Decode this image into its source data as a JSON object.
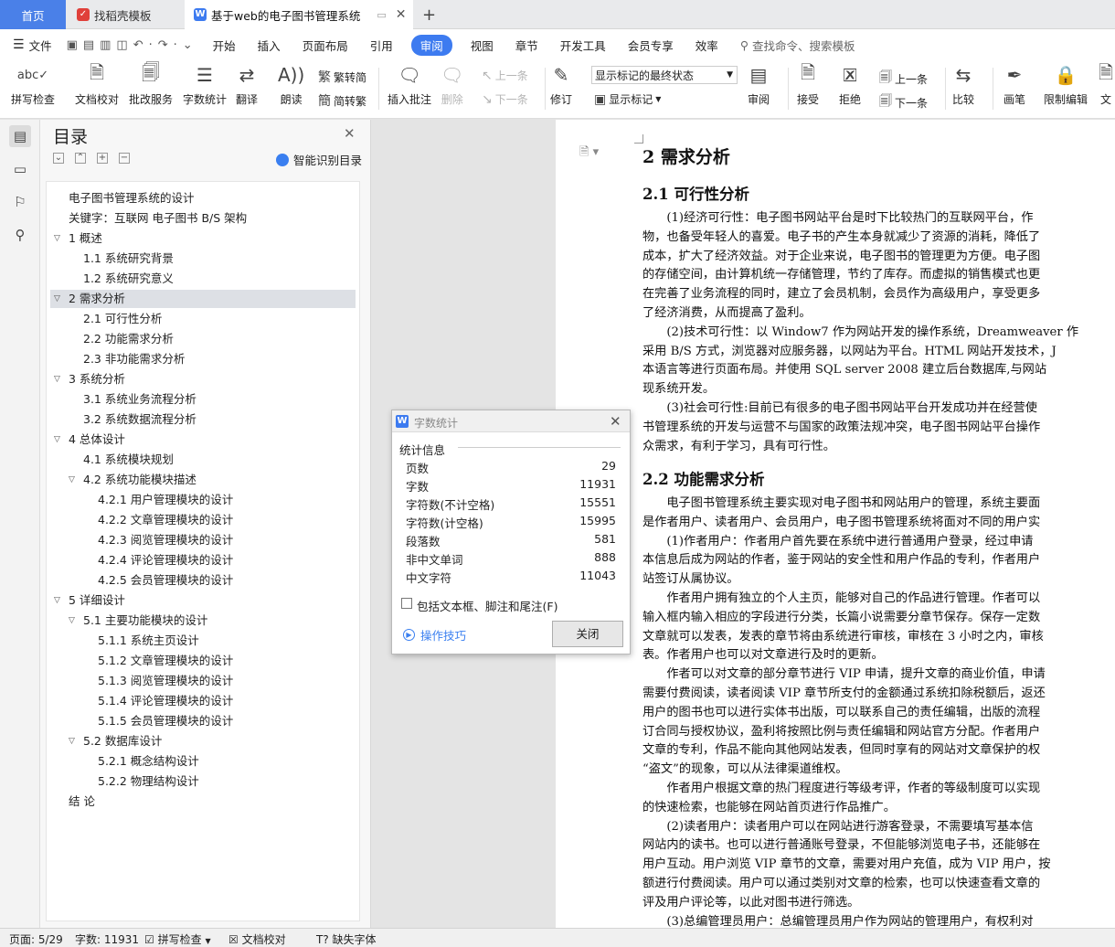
{
  "tabs": {
    "home": "首页",
    "template": "找稻壳模板",
    "doc": "基于web的电子图书管理系统",
    "add": "+"
  },
  "menu": {
    "file": "文件",
    "items": [
      "开始",
      "插入",
      "页面布局",
      "引用",
      "审阅",
      "视图",
      "章节",
      "开发工具",
      "会员专享",
      "效率"
    ],
    "active": "审阅",
    "search": "查找命令、搜索模板"
  },
  "toolbar": {
    "spell": "拼写检查",
    "proof": "文档校对",
    "batch": "批改服务",
    "wordcount": "字数统计",
    "translate": "翻译",
    "read": "朗读",
    "to_trad": "繁转简",
    "to_simp": "简转繁",
    "insert_comment": "插入批注",
    "delete": "删除",
    "prev": "上一条",
    "next": "下一条",
    "revise": "修订",
    "markup_select": "显示标记的最终状态",
    "show_markup": "显示标记",
    "review": "审阅",
    "accept": "接受",
    "reject": "拒绝",
    "prev2": "上一条",
    "next2": "下一条",
    "compare": "比较",
    "ink": "画笔",
    "restrict": "限制编辑",
    "doc_cut": "文"
  },
  "toc": {
    "title": "目录",
    "smart": "智能识别目录",
    "items": [
      {
        "text": "电子图书管理系统的设计",
        "level": 0,
        "arrow": ""
      },
      {
        "text": "关键字：互联网  电子图书  B/S 架构",
        "level": 0,
        "arrow": ""
      },
      {
        "text": "1 概述",
        "level": 0,
        "arrow": "v"
      },
      {
        "text": "1.1 系统研究背景",
        "level": 1,
        "arrow": ""
      },
      {
        "text": "1.2 系统研究意义",
        "level": 1,
        "arrow": ""
      },
      {
        "text": "2  需求分析",
        "level": 0,
        "arrow": "v",
        "selected": true
      },
      {
        "text": "2.1 可行性分析",
        "level": 1,
        "arrow": ""
      },
      {
        "text": "2.2 功能需求分析",
        "level": 1,
        "arrow": ""
      },
      {
        "text": "2.3 非功能需求分析",
        "level": 1,
        "arrow": ""
      },
      {
        "text": "3 系统分析",
        "level": 0,
        "arrow": "v"
      },
      {
        "text": "3.1 系统业务流程分析",
        "level": 1,
        "arrow": ""
      },
      {
        "text": "3.2 系统数据流程分析",
        "level": 1,
        "arrow": ""
      },
      {
        "text": "4 总体设计",
        "level": 0,
        "arrow": "v"
      },
      {
        "text": "4.1 系统模块规划",
        "level": 1,
        "arrow": ""
      },
      {
        "text": "4.2 系统功能模块描述",
        "level": 1,
        "arrow": "v"
      },
      {
        "text": "4.2.1 用户管理模块的设计",
        "level": 2,
        "arrow": ""
      },
      {
        "text": "4.2.2 文章管理模块的设计",
        "level": 2,
        "arrow": ""
      },
      {
        "text": "4.2.3 阅览管理模块的设计",
        "level": 2,
        "arrow": ""
      },
      {
        "text": "4.2.4 评论管理模块的设计",
        "level": 2,
        "arrow": ""
      },
      {
        "text": "4.2.5 会员管理模块的设计",
        "level": 2,
        "arrow": ""
      },
      {
        "text": "5 详细设计",
        "level": 0,
        "arrow": "v"
      },
      {
        "text": "5.1 主要功能模块的设计",
        "level": 1,
        "arrow": "v"
      },
      {
        "text": "5.1.1 系统主页设计",
        "level": 2,
        "arrow": ""
      },
      {
        "text": "5.1.2 文章管理模块的设计",
        "level": 2,
        "arrow": ""
      },
      {
        "text": "5.1.3 阅览管理模块的设计",
        "level": 2,
        "arrow": ""
      },
      {
        "text": "5.1.4 评论管理模块的设计",
        "level": 2,
        "arrow": ""
      },
      {
        "text": "5.1.5 会员管理模块的设计",
        "level": 2,
        "arrow": ""
      },
      {
        "text": "5.2 数据库设计",
        "level": 1,
        "arrow": "v"
      },
      {
        "text": "5.2.1 概念结构设计",
        "level": 2,
        "arrow": ""
      },
      {
        "text": "5.2.2 物理结构设计",
        "level": 2,
        "arrow": ""
      },
      {
        "text": "结    论",
        "level": 0,
        "arrow": ""
      }
    ]
  },
  "doc": {
    "h1": "2 需求分析",
    "h2a": "2.1 可行性分析",
    "h2b": "2.2 功能需求分析",
    "lines_a": [
      "　　(1)经济可行性：电子图书网站平台是时下比较热门的互联网平台，作",
      "物，也备受年轻人的喜爱。电子书的产生本身就减少了资源的消耗，降低了",
      "成本，扩大了经济效益。对于企业来说，电子图书的管理更为方便。电子图",
      "的存储空间，由计算机统一存储管理，节约了库存。而虚拟的销售模式也更",
      "在完善了业务流程的同时，建立了会员机制，会员作为高级用户，享受更多",
      "了经济消费，从而提高了盈利。",
      "　　(2)技术可行性：以 Window7 作为网站开发的操作系统，Dreamweaver 作",
      "采用 B/S 方式，浏览器对应服务器，以网站为平台。HTML 网站开发技术，J",
      "本语言等进行页面布局。并使用 SQL server 2008 建立后台数据库,与网站",
      "现系统开发。",
      "　　(3)社会可行性:目前已有很多的电子图书网站平台开发成功并在经营使",
      "书管理系统的开发与运营不与国家的政策法规冲突，电子图书网站平台操作",
      "众需求，有利于学习，具有可行性。"
    ],
    "lines_b": [
      "　　电子图书管理系统主要实现对电子图书和网站用户的管理，系统主要面",
      "是作者用户、读者用户、会员用户，电子图书管理系统将面对不同的用户实",
      "　　(1)作者用户：作者用户首先要在系统中进行普通用户登录，经过申请",
      "本信息后成为网站的作者，鉴于网站的安全性和用户作品的专利，作者用户",
      "站签订从属协议。",
      "　　作者用户拥有独立的个人主页，能够对自己的作品进行管理。作者可以",
      "输入框内输入相应的字段进行分类，长篇小说需要分章节保存。保存一定数",
      "文章就可以发表，发表的章节将由系统进行审核，审核在 3 小时之内，审核",
      "表。作者用户也可以对文章进行及时的更新。",
      "　　作者可以对文章的部分章节进行 VIP 申请，提升文章的商业价值，申请",
      "需要付费阅读，读者阅读 VIP 章节所支付的金额通过系统扣除税额后，返还",
      "用户的图书也可以进行实体书出版，可以联系自己的责任编辑，出版的流程",
      "订合同与授权协议，盈利将按照比例与责任编辑和网站官方分配。作者用户",
      "文章的专利，作品不能向其他网站发表，但同时享有的网站对文章保护的权",
      "“盗文”的现象，可以从法律渠道维权。",
      "　　作者用户根据文章的热门程度进行等级考评，作者的等级制度可以实现",
      "的快速检索，也能够在网站首页进行作品推广。",
      "　　(2)读者用户：读者用户可以在网站进行游客登录，不需要填写基本信",
      "网站内的读书。也可以进行普通账号登录，不但能够浏览电子书，还能够在",
      "用户互动。用户浏览 VIP 章节的文章，需要对用户充值，成为 VIP 用户，按",
      "额进行付费阅读。用户可以通过类别对文章的检索，也可以快速查看文章的",
      "评及用户评论等，以此对图书进行筛选。",
      "　　(3)总编管理员用户：总编管理员用户作为网站的管理用户，有权利对"
    ]
  },
  "dialog": {
    "title": "字数统计",
    "section": "统计信息",
    "stats": [
      {
        "label": "页数",
        "value": "29"
      },
      {
        "label": "字数",
        "value": "11931"
      },
      {
        "label": "字符数(不计空格)",
        "value": "15551"
      },
      {
        "label": "字符数(计空格)",
        "value": "15995"
      },
      {
        "label": "段落数",
        "value": "581"
      },
      {
        "label": "非中文单词",
        "value": "888"
      },
      {
        "label": "中文字符",
        "value": "11043"
      }
    ],
    "include": "包括文本框、脚注和尾注(F)",
    "tips": "操作技巧",
    "close": "关闭"
  },
  "status": {
    "page": "页面: 5/29",
    "words": "字数: 11931",
    "spell": "拼写检查",
    "proof": "文档校对",
    "font": "缺失字体"
  },
  "colors": {
    "accent": "#3d7bf0",
    "home_tab": "#4a80e8",
    "template_icon": "#e0403a"
  }
}
